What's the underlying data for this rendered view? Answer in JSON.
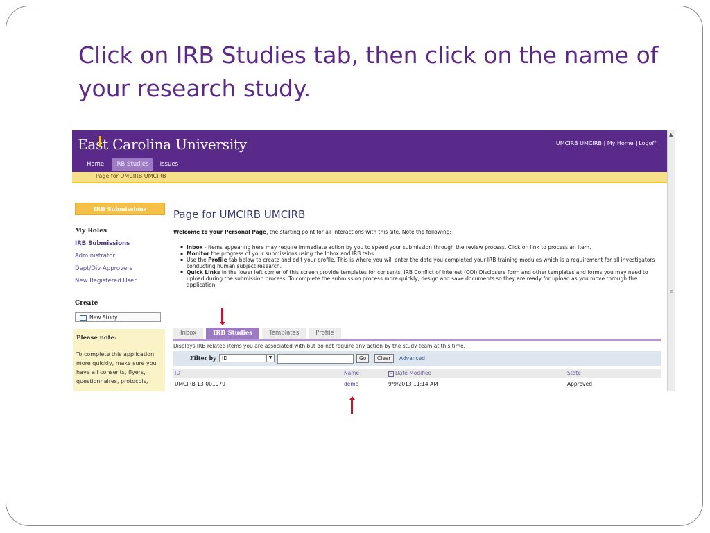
{
  "slide": {
    "title": "Click on IRB Studies tab, then click on the name of your research study."
  },
  "app": {
    "logo_text": "East Carolina University",
    "top_links": "UMCIRB UMCIRB | My Home |   Logoff",
    "nav": [
      "Home",
      "IRB Studies",
      "Issues"
    ],
    "breadcrumb": "Page for UMCIRB UMCIRB"
  },
  "sidebar": {
    "submissions_header": "IRB Submissions",
    "roles_title": "My Roles",
    "roles": [
      "IRB Submissions",
      "Administrator",
      "Dept/Div Approvers",
      "New Registered User"
    ],
    "create_title": "Create",
    "new_study_label": "New Study",
    "note_title": "Please note:",
    "note_text": "To complete this application more quickly, make sure you have all consents, flyers, questionnaires, protocols,"
  },
  "main": {
    "heading": "Page for UMCIRB UMCIRB",
    "welcome_bold": "Welcome to your Personal Page",
    "welcome_rest": ", the starting point for all interactions with this site.  Note the following:",
    "bullets": [
      {
        "bold": "Inbox",
        "text": "  - Items appearing here may require immediate action by you to speed your submission through the review process.  Click on link to process an item."
      },
      {
        "bold": "Monitor",
        "text": " the progress of your submissions using the Inbox and IRB tabs."
      },
      {
        "pre": "Use the ",
        "bold": "Profile",
        "text": " tab below to create and edit your profile.  This is where you will enter the date you completed your IRB training modules which is a requirement for all investigators conducting human subject research."
      },
      {
        "bold": "Quick Links",
        "text": " in the lower left corner of this screen provide templates for consents, IRB Conflict of Interest (COI) Disclosure form and other templates and forms you may need to upload during the submission process.  To complete the submission process more quickly, design and save documents so they are ready for upload as you move through the application."
      }
    ],
    "tabs": [
      "Inbox",
      "IRB Studies",
      "Templates",
      "Profile"
    ],
    "tab_description": "Displays IRB related items you are associated with but do not require any action by the study team at this time.",
    "filter": {
      "label": "Filter by",
      "selected": "ID",
      "input_value": "",
      "go": "Go",
      "clear": "Clear",
      "advanced": "Advanced"
    },
    "table": {
      "headers": [
        "ID",
        "Name",
        "Date Modified",
        "State"
      ],
      "rows": [
        [
          "UMCIRB 13-001979",
          "demo",
          "9/9/2013 11:14 AM",
          "Approved"
        ]
      ]
    }
  }
}
